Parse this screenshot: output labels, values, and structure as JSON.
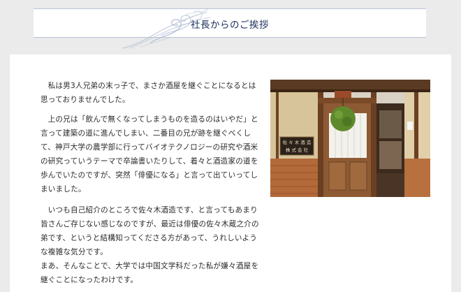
{
  "header": {
    "title": "社長からのご挨拶"
  },
  "content": {
    "paragraphs": [
      "私は男3人兄弟の末っ子で、まさか酒屋を継ぐことになるとは思っておりませんでした。",
      "上の兄は「飲んで無くなってしまうものを造るのはいやだ」と言って建築の道に進んでしまい、二番目の兄が跡を継ぐべくして、神戸大学の農学部に行ってバイオテクノロジーの研究や酒米の研究っていうテーマで卒論書いたりして、着々と酒造家の道を歩んでいたのですが、突然「俳優になる」と言って出ていってしまいました。",
      "いつも自己紹介のところで佐々木酒造です、と言ってもあまり皆さんご存じない感じなのですが、最近は俳優の佐々木蔵之介の弟です、というと結構知ってくださる方があって、うれしいような複雑な気分です。",
      "まあ、そんなことで、大学では中国文学科だった私が嫌々酒屋を継ぐことになったわけです。"
    ]
  },
  "photo": {
    "sign_text": "佐々木酒造株式会社"
  },
  "colors": {
    "title": "#1c2f5e",
    "background": "#ebebeb",
    "card": "#ffffff",
    "accent_wave": "#9aa8c6"
  }
}
